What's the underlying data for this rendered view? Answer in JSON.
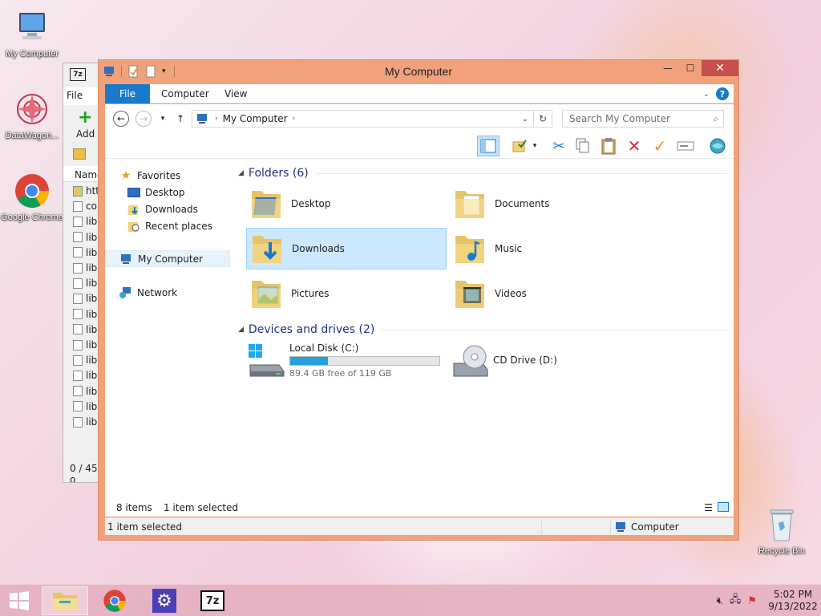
{
  "desktop": {
    "icons": [
      {
        "label": "My Computer"
      },
      {
        "label": "DataWagon..."
      },
      {
        "label": "Google Chrome"
      },
      {
        "label": "Recycle Bin"
      }
    ]
  },
  "background_window": {
    "file_menu": "File",
    "add_label": "Add",
    "name_header": "Name",
    "rows": [
      "htt",
      "co",
      "lib",
      "lib",
      "lib",
      "lib",
      "lib",
      "lib",
      "lib",
      "lib",
      "lib",
      "lib",
      "lib",
      "lib",
      "lib",
      "lib"
    ],
    "status": "0 / 45 o"
  },
  "window": {
    "title": "My Computer",
    "tabs": [
      "File",
      "Computer",
      "View"
    ],
    "address": "My Computer",
    "search_placeholder": "Search My Computer",
    "nav": {
      "favorites": "Favorites",
      "desktop": "Desktop",
      "downloads": "Downloads",
      "recent": "Recent places",
      "my_computer": "My Computer",
      "network": "Network"
    },
    "folders_header": "Folders (6)",
    "folders": [
      "Desktop",
      "Documents",
      "Downloads",
      "Music",
      "Pictures",
      "Videos"
    ],
    "devices_header": "Devices and drives (2)",
    "drives": {
      "c_name": "Local Disk (C:)",
      "c_free": "89.4 GB free of 119 GB",
      "c_used_fraction": 0.25,
      "d_name": "CD Drive (D:)"
    },
    "status": {
      "items": "8 items",
      "selected": "1 item selected",
      "bottom_selected": "1 item selected",
      "bottom_location": "Computer"
    }
  },
  "taskbar": {
    "time": "5:02 PM",
    "date": "9/13/2022"
  },
  "colors": {
    "accent": "#1979ca",
    "title_frame": "#f1a27c",
    "close_button": "#c7504a",
    "selection": "#cce8ff",
    "drive_bar": "#26a0da"
  }
}
